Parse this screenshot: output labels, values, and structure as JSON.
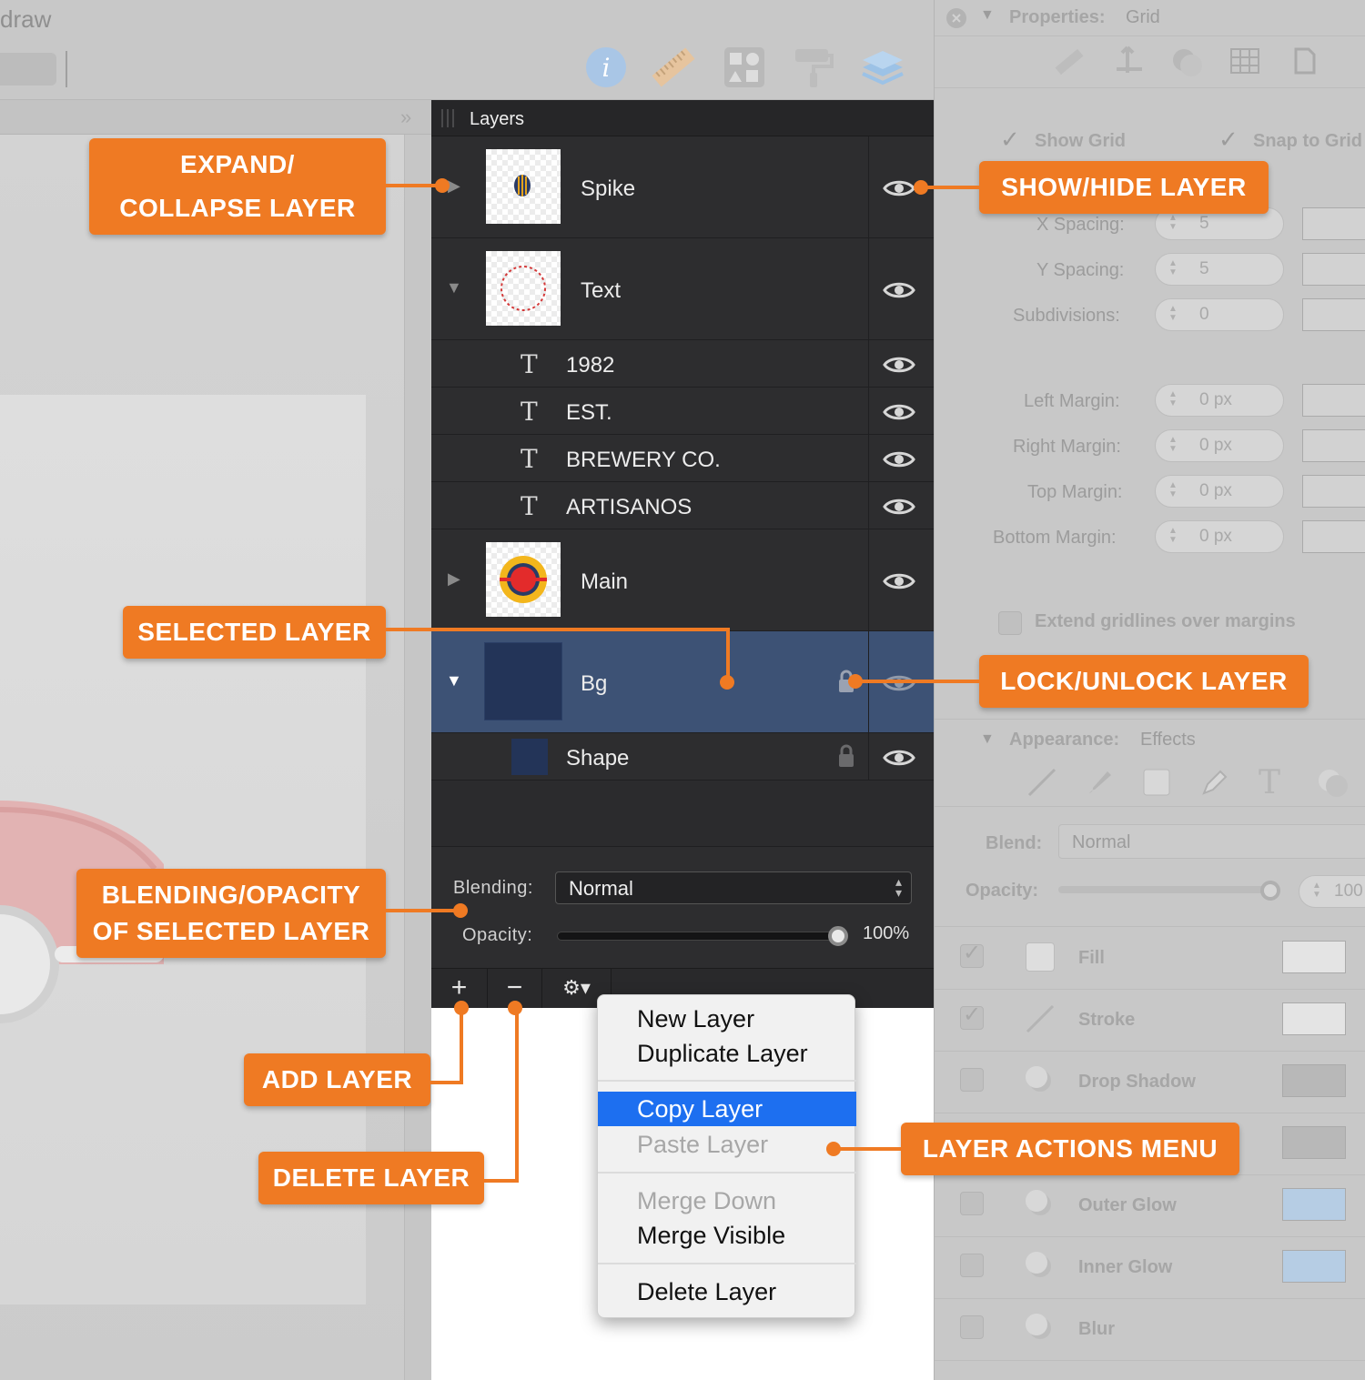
{
  "app": {
    "title": "draw"
  },
  "toolbar_icons": [
    "info-icon",
    "ruler-icon",
    "shapes-icon",
    "paint-roller-icon",
    "layers-stack-icon"
  ],
  "layers_panel": {
    "title": "Layers",
    "layers": [
      {
        "name": "Spike",
        "expanded": false
      },
      {
        "name": "Text",
        "expanded": true,
        "children": [
          "1982",
          "EST.",
          "BREWERY CO.",
          "ARTISANOS"
        ]
      },
      {
        "name": "Main",
        "expanded": false
      },
      {
        "name": "Bg",
        "expanded": true,
        "selected": true,
        "locked": true,
        "children": [
          "Shape"
        ]
      }
    ],
    "text_glyph": "T",
    "blending_label": "Blending:",
    "blending_value": "Normal",
    "opacity_label": "Opacity:",
    "opacity_value": "100%",
    "opacity_fraction": 1.0,
    "add_label": "+",
    "remove_label": "−",
    "gear_label": "⚙▾"
  },
  "context_menu": {
    "items": [
      {
        "label": "New Layer",
        "enabled": true
      },
      {
        "label": "Duplicate Layer",
        "enabled": true
      },
      {
        "label": "Copy Layer",
        "enabled": true,
        "highlighted": true
      },
      {
        "label": "Paste Layer",
        "enabled": false
      },
      {
        "label": "Merge Down",
        "enabled": false
      },
      {
        "label": "Merge Visible",
        "enabled": true
      },
      {
        "label": "Delete Layer",
        "enabled": true
      }
    ]
  },
  "properties": {
    "title": "Properties:",
    "subtitle": "Grid",
    "show_grid": "Show Grid",
    "snap_to_grid": "Snap to Grid",
    "fields": [
      {
        "label": "X Spacing:",
        "value": "5"
      },
      {
        "label": "Y Spacing:",
        "value": "5"
      },
      {
        "label": "Subdivisions:",
        "value": "0"
      },
      {
        "label": "Left Margin:",
        "value": "0 px"
      },
      {
        "label": "Right Margin:",
        "value": "0 px"
      },
      {
        "label": "Top Margin:",
        "value": "0 px"
      },
      {
        "label": "Bottom Margin:",
        "value": "0 px"
      }
    ],
    "extend_gridlines": "Extend gridlines over margins",
    "appearance_title": "Appearance:",
    "appearance_subtitle": "Effects",
    "blend_label": "Blend:",
    "blend_value": "Normal",
    "opacity_label": "Opacity:",
    "opacity_value": "100",
    "effects": [
      "Fill",
      "Stroke",
      "Drop Shadow",
      "Outer Glow",
      "Inner Glow",
      "Blur"
    ]
  },
  "callouts": {
    "expand": [
      "EXPAND/",
      "COLLAPSE LAYER"
    ],
    "show_hide": "SHOW/HIDE LAYER",
    "selected": "SELECTED LAYER",
    "lock": "LOCK/UNLOCK LAYER",
    "blending": [
      "BLENDING/OPACITY",
      "OF SELECTED LAYER"
    ],
    "add": "ADD LAYER",
    "delete": "DELETE LAYER",
    "actions": "LAYER ACTIONS MENU"
  },
  "colors": {
    "accent": "#ef7a23",
    "selection": "#3d5275",
    "menu_highlight": "#1d6ff0",
    "panel_bg": "#2d2d2f"
  }
}
